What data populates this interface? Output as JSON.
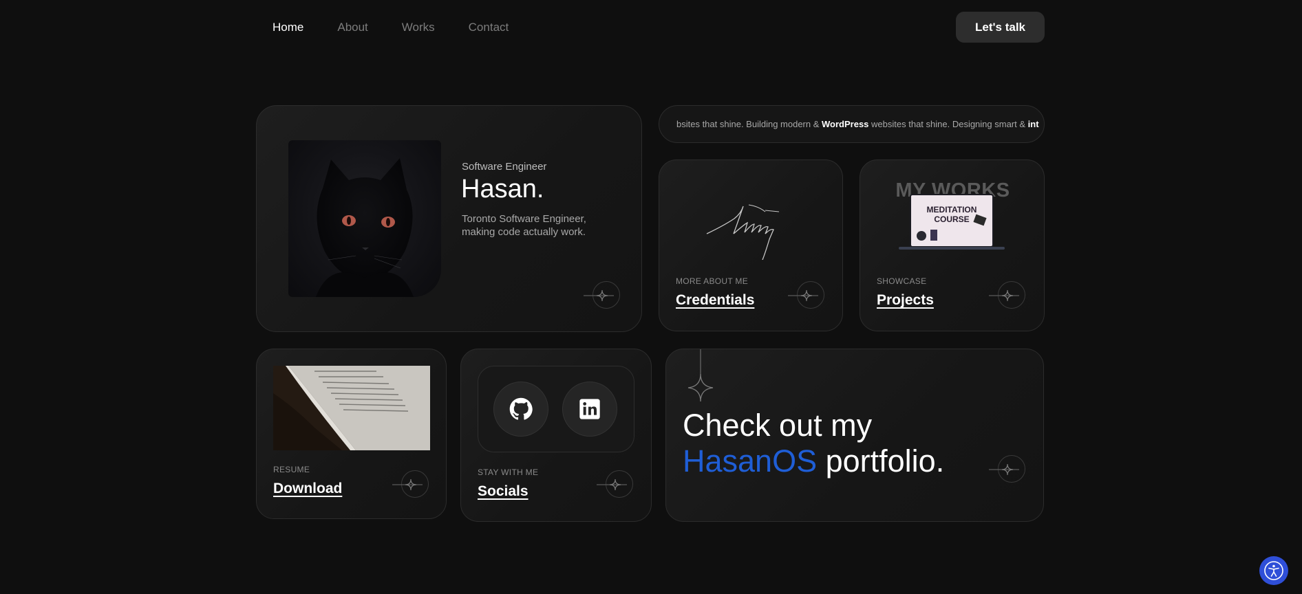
{
  "nav": {
    "items": [
      {
        "label": "Home",
        "active": true
      },
      {
        "label": "About",
        "active": false
      },
      {
        "label": "Works",
        "active": false
      },
      {
        "label": "Contact",
        "active": false
      }
    ],
    "cta_label": "Let's talk"
  },
  "profile": {
    "role": "Software Engineer",
    "name": "Hasan.",
    "description": "Toronto Software Engineer, making code actually work.",
    "photo_icon": "black-cat-photo"
  },
  "ticker": {
    "segments": [
      {
        "text": "bsites that shine. Building modern & ",
        "bold": false
      },
      {
        "text": "WordPress",
        "bold": true
      },
      {
        "text": " websites that shine. Designing smart & ",
        "bold": false
      },
      {
        "text": "int",
        "bold": true
      }
    ]
  },
  "credentials": {
    "eyebrow": "MORE ABOUT ME",
    "title": "Credentials",
    "image_icon": "signature-icon"
  },
  "projects": {
    "eyebrow": "SHOWCASE",
    "title": "Projects",
    "image_heading": "MY WORKS",
    "laptop_line1": "MEDITATION",
    "laptop_line2": "COURSE"
  },
  "resume": {
    "eyebrow": "RESUME",
    "title": "Download",
    "image_icon": "paper-document-photo"
  },
  "socials": {
    "eyebrow": "STAY WITH ME",
    "title": "Socials",
    "icons": [
      "github-icon",
      "linkedin-icon"
    ]
  },
  "cta": {
    "line1": "Check out my",
    "accent": "HasanOS",
    "line2_rest": " portfolio."
  },
  "colors": {
    "background": "#0f0f0f",
    "accent": "#1f5ed6",
    "card_border": "#2c2c2c",
    "accessibility_button": "#2f4fd8"
  }
}
